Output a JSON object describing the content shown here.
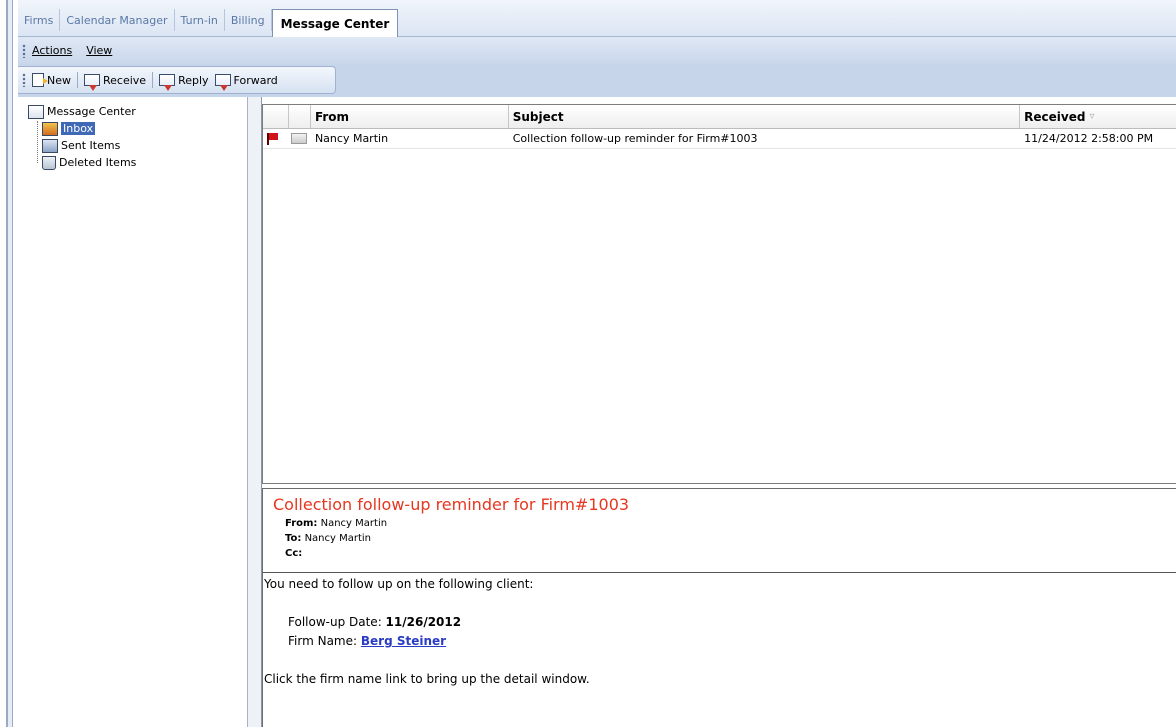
{
  "tabs": [
    {
      "label": "Firms"
    },
    {
      "label": "Calendar Manager"
    },
    {
      "label": "Turn-in"
    },
    {
      "label": "Billing"
    },
    {
      "label": "Message Center",
      "active": true
    }
  ],
  "menu": {
    "actions": "Actions",
    "view": "View"
  },
  "toolbar": {
    "new": "New",
    "receive": "Receive",
    "reply": "Reply",
    "forward": "Forward"
  },
  "tree": {
    "root": "Message Center",
    "items": [
      {
        "label": "Inbox",
        "selected": true,
        "icon": "inbox-icon"
      },
      {
        "label": "Sent Items",
        "icon": "sent-items-icon"
      },
      {
        "label": "Deleted Items",
        "icon": "deleted-items-icon"
      }
    ]
  },
  "message_list": {
    "columns": {
      "from": "From",
      "subject": "Subject",
      "received": "Received"
    },
    "rows": [
      {
        "flag": "red",
        "from": "Nancy Martin",
        "subject": "Collection follow-up reminder for Firm#1003",
        "received": "11/24/2012 2:58:00 PM"
      }
    ]
  },
  "preview": {
    "subject": "Collection follow-up reminder for Firm#1003",
    "from_label": "From:",
    "from_value": "Nancy Martin",
    "to_label": "To:",
    "to_value": "Nancy Martin",
    "cc_label": "Cc:",
    "cc_value": "",
    "body_intro": "You need to follow up on the following client:",
    "followup_label": "Follow-up Date: ",
    "followup_value": "11/26/2012",
    "firm_label": "Firm Name: ",
    "firm_value": "Berg Steiner",
    "body_outro": "Click the firm name link to bring up the detail window."
  },
  "colors": {
    "accent": "#3f68b6",
    "subject_red": "#e8361f",
    "link": "#2b3cc4",
    "flag": "#d1141c"
  }
}
